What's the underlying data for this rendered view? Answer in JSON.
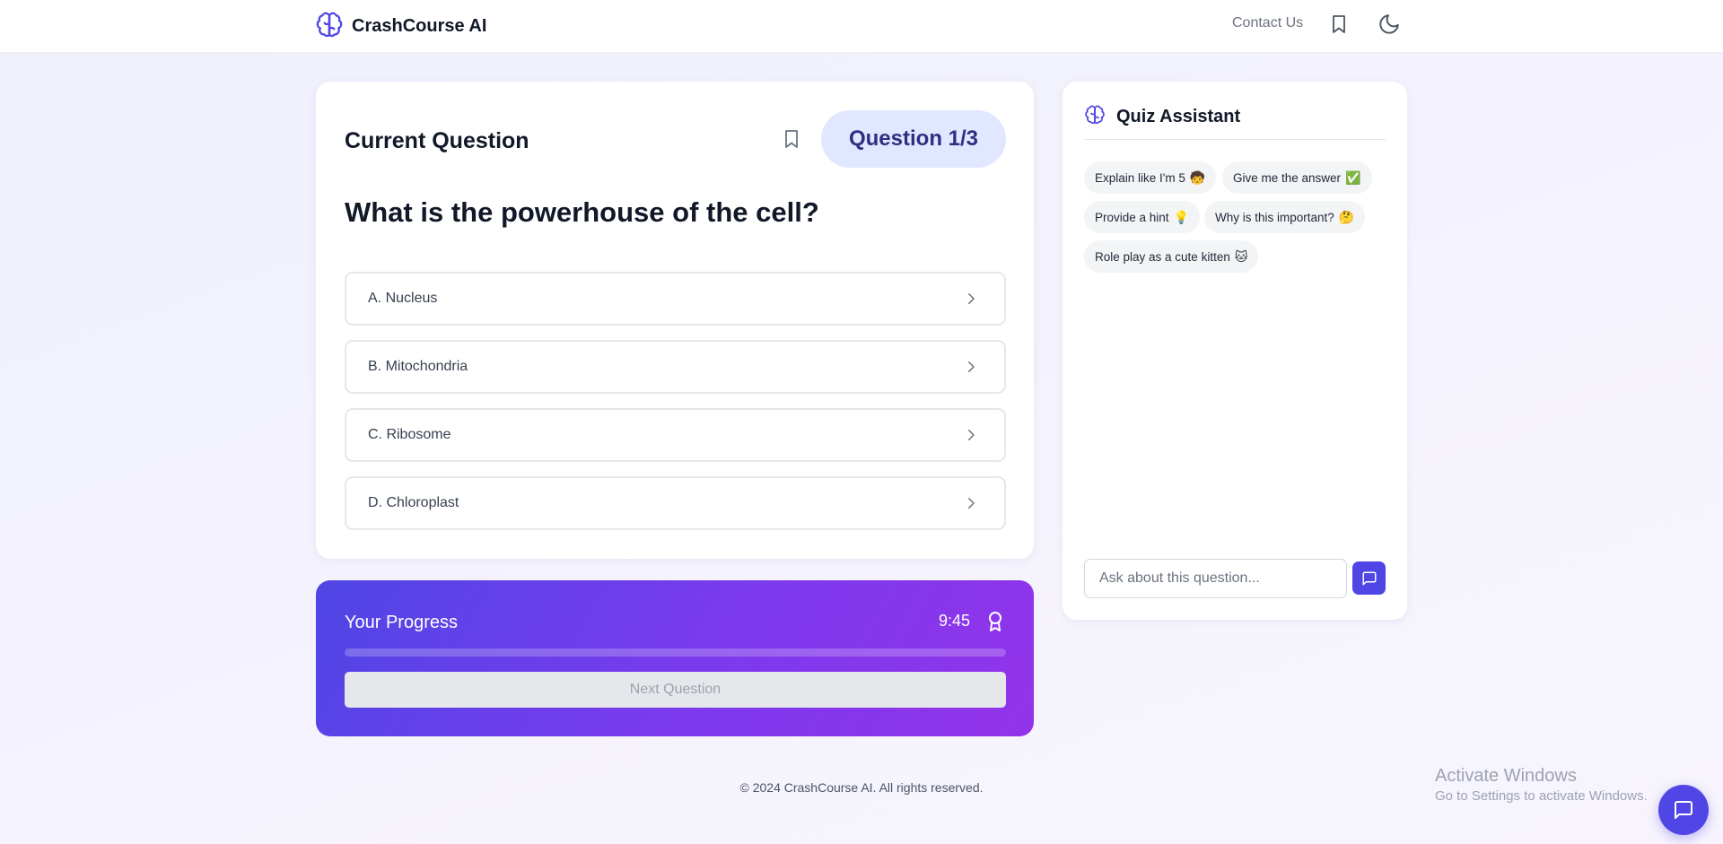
{
  "header": {
    "brand": "CrashCourse AI",
    "contact": "Contact Us",
    "icons": [
      "brain-icon",
      "bookmark-icon",
      "moon-icon"
    ]
  },
  "question_card": {
    "title": "Current Question",
    "badge": "Question 1/3",
    "question": "What is the powerhouse of the cell?",
    "options": [
      {
        "label": "A. Nucleus"
      },
      {
        "label": "B. Mitochondria"
      },
      {
        "label": "C. Ribosome"
      },
      {
        "label": "D. Chloroplast"
      }
    ]
  },
  "progress": {
    "title": "Your Progress",
    "time": "9:45",
    "fraction": 0.0,
    "next_label": "Next Question"
  },
  "assistant": {
    "title": "Quiz Assistant",
    "chips": [
      {
        "label": "Explain like I'm 5",
        "emoji": "🧒"
      },
      {
        "label": "Give me the answer",
        "emoji": "✅"
      },
      {
        "label": "Provide a hint",
        "emoji": "💡"
      },
      {
        "label": "Why is this important?",
        "emoji": "🤔"
      },
      {
        "label": "Role play as a cute kitten",
        "emoji": "🐱"
      }
    ],
    "input_placeholder": "Ask about this question..."
  },
  "footer": {
    "text": "© 2024 CrashCourse AI. All rights reserved."
  },
  "watermark": {
    "line1": "Activate Windows",
    "line2": "Go to Settings to activate Windows."
  },
  "colors": {
    "accent": "#4f46e5",
    "badge_bg": "#e0e7ff",
    "badge_text": "#312e81",
    "gradient_start": "#4f46e5",
    "gradient_end": "#9333ea"
  }
}
